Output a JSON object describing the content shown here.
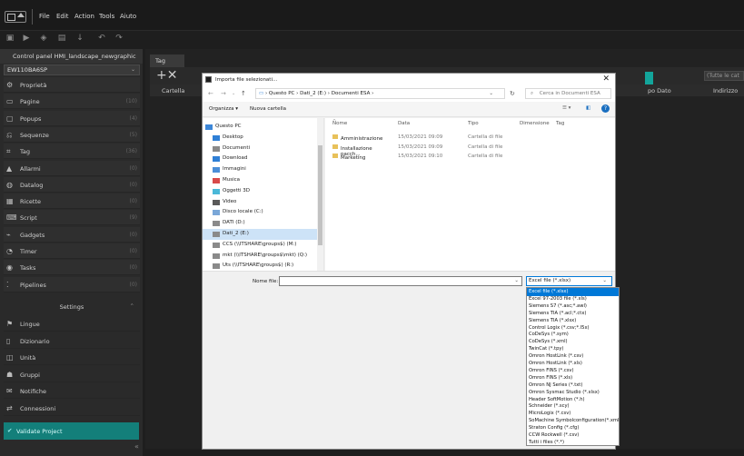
{
  "menubar": {
    "items": [
      "File",
      "Edit",
      "Action",
      "Tools",
      "Aiuto"
    ]
  },
  "sidebar": {
    "project": "Control panel HMI_landscape_newgraphic",
    "device": "EW110BA6SP",
    "items": [
      {
        "label": "Proprietà",
        "count": "",
        "icon": "gear-icon"
      },
      {
        "label": "Pagine",
        "count": "(10)",
        "icon": "page-icon"
      },
      {
        "label": "Popups",
        "count": "(4)",
        "icon": "popup-icon"
      },
      {
        "label": "Sequenze",
        "count": "(5)",
        "icon": "sequence-icon"
      },
      {
        "label": "Tag",
        "count": "(36)",
        "icon": "tag-icon"
      },
      {
        "label": "Allarmi",
        "count": "(0)",
        "icon": "alarm-icon"
      },
      {
        "label": "Datalog",
        "count": "(0)",
        "icon": "database-icon"
      },
      {
        "label": "Ricette",
        "count": "(0)",
        "icon": "recipe-icon"
      },
      {
        "label": "Script",
        "count": "(9)",
        "icon": "script-icon"
      },
      {
        "label": "Gadgets",
        "count": "(0)",
        "icon": "gadget-icon"
      },
      {
        "label": "Timer",
        "count": "(0)",
        "icon": "timer-icon"
      },
      {
        "label": "Tasks",
        "count": "(0)",
        "icon": "tasks-icon"
      },
      {
        "label": "Pipelines",
        "count": "(0)",
        "icon": "pipeline-icon"
      }
    ],
    "settings_label": "Settings",
    "settings_items": [
      {
        "label": "Lingue",
        "icon": "language-icon"
      },
      {
        "label": "Dizionario",
        "icon": "dictionary-icon"
      },
      {
        "label": "Unità",
        "icon": "unit-icon"
      },
      {
        "label": "Gruppi",
        "icon": "group-icon"
      },
      {
        "label": "Notifiche",
        "icon": "notification-icon"
      },
      {
        "label": "Connessioni",
        "icon": "connection-icon"
      }
    ],
    "validate": "Validate Project"
  },
  "main": {
    "tab": "Tag",
    "filter_placeholder": "(Tutte le cat",
    "columns": [
      "Cartella",
      "po Dato",
      "Indirizzo"
    ]
  },
  "dialog": {
    "title": "Importa file selezionati...",
    "address": [
      "Questo PC",
      "Dati_2 (E:)",
      "Documenti ESA"
    ],
    "search_placeholder": "Cerca in Documenti ESA",
    "organize": "Organizza",
    "new_folder": "Nuova cartella",
    "tree": [
      {
        "label": "Questo PC",
        "color": "#3d87d8"
      },
      {
        "label": "Desktop",
        "color": "#2f7fd6"
      },
      {
        "label": "Documenti",
        "color": "#8a8a8a"
      },
      {
        "label": "Download",
        "color": "#2f7fd6"
      },
      {
        "label": "Immagini",
        "color": "#4a8ed8"
      },
      {
        "label": "Musica",
        "color": "#d84a4a"
      },
      {
        "label": "Oggetti 3D",
        "color": "#4ab8d8"
      },
      {
        "label": "Video",
        "color": "#5a5a5a"
      },
      {
        "label": "Disco locale (C:)",
        "color": "#7aa7d8"
      },
      {
        "label": "DATI (D:)",
        "color": "#8a8a8a"
      },
      {
        "label": "Dati_2 (E:)",
        "color": "#8a8a8a"
      },
      {
        "label": "CCS (\\\\ITSHARE\\groups$) (M:)",
        "color": "#8a8a8a"
      },
      {
        "label": "mkt (\\\\ITSHARE\\groups$\\mkt) (Q:)",
        "color": "#8a8a8a"
      },
      {
        "label": "Uts (\\\\ITSHARE\\groups$) (R:)",
        "color": "#8a8a8a"
      }
    ],
    "file_headers": [
      "Nome",
      "Data",
      "Tipo",
      "Dimensione",
      "Tag"
    ],
    "files": [
      {
        "name": "Amministrazione",
        "date": "15/03/2021 09:09",
        "type": "Cartella di file"
      },
      {
        "name": "Installazione pacch...",
        "date": "15/03/2021 09:09",
        "type": "Cartella di file"
      },
      {
        "name": "Marketing",
        "date": "15/03/2021 09:10",
        "type": "Cartella di file"
      }
    ],
    "filename_label": "Nome file:",
    "filetype_selected": "Excel file (*.xlsx)",
    "filetype_options": [
      "Excel file (*.xlsx)",
      "Excel 97-2003 file (*.xls)",
      "Siemens S7 (*.asc;*.awl)",
      "Siemens TIA (*.acl;*.ctx)",
      "Siemens TIA (*.xlsx)",
      "Control Logix (*.csv;*.l5x)",
      "CoDeSys (*.sym)",
      "CoDeSys (*.xml)",
      "TwinCat (*.tpy)",
      "Omron HostLink (*.csv)",
      "Omron HostLink (*.xls)",
      "Omron FINS (*.csv)",
      "Omron FINS (*.xls)",
      "Omron NJ Series (*.txt)",
      "Omron Sysmac Studio (*.xlsx)",
      "Header SoftMotion (*.h)",
      "Schneider (*.scy)",
      "MicroLogix (*.csv)",
      "SoMachine Symbolconfiguration(*.xml)",
      "Straton Config (*.cfg)",
      "CCW Rockwell (*.csv)",
      "Tutti i files (*.*)"
    ]
  },
  "colors": {
    "accent": "#137f7a",
    "select": "#0078d7"
  }
}
